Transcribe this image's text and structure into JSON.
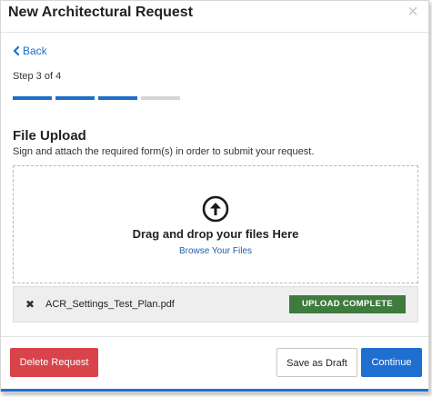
{
  "header": {
    "title": "New Architectural Request",
    "close_glyph": "×"
  },
  "nav": {
    "back_label": "Back"
  },
  "progress": {
    "step_text": "Step 3 of 4",
    "current_step": 3,
    "total_steps": 4,
    "active_color": "#1f6fc8",
    "inactive_color": "#d6d6d6"
  },
  "upload": {
    "title": "File Upload",
    "subtitle": "Sign and attach the required form(s) in order to submit your request.",
    "drop_text": "Drag and drop your files Here",
    "browse_label": "Browse Your Files",
    "icon": "arrow-up-circle-icon"
  },
  "files": [
    {
      "name": "ACR_Settings_Test_Plan.pdf",
      "status": "UPLOAD COMPLETE",
      "status_color": "#3e7b3e",
      "remove_glyph": "✖"
    }
  ],
  "footer": {
    "delete_label": "Delete Request",
    "draft_label": "Save as Draft",
    "continue_label": "Continue",
    "delete_color": "#d9434b",
    "continue_color": "#1f6fd1"
  }
}
